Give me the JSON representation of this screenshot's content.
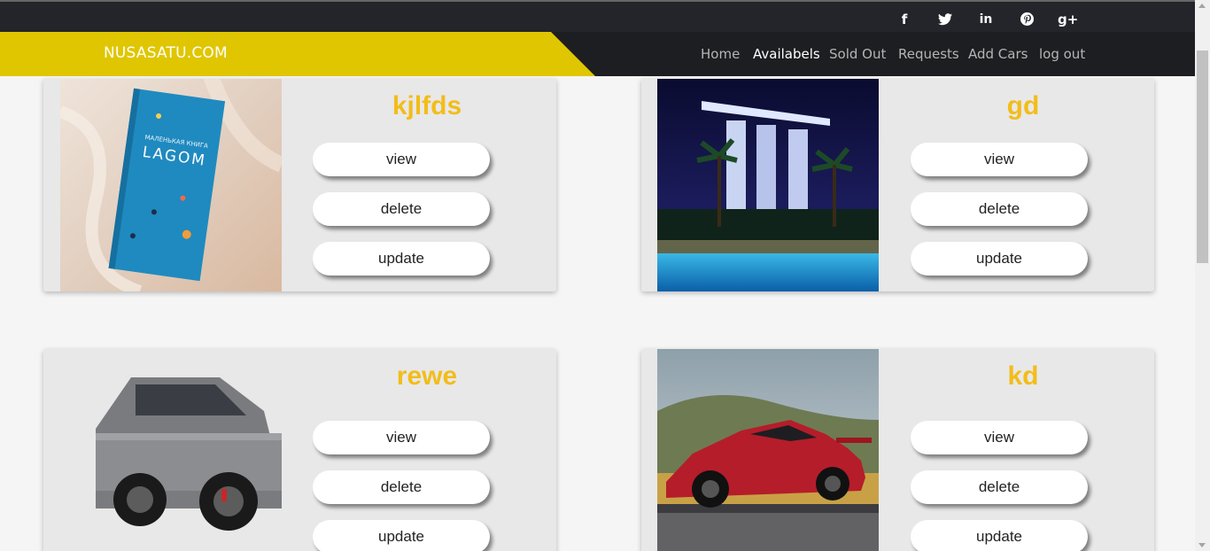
{
  "brand": "NUSASATU.COM",
  "social": [
    {
      "icon": "facebook-icon",
      "glyph": "f"
    },
    {
      "icon": "twitter-icon",
      "glyph": "t"
    },
    {
      "icon": "linkedin-icon",
      "glyph": "in"
    },
    {
      "icon": "pinterest-icon",
      "glyph": "p"
    },
    {
      "icon": "google-plus-icon",
      "glyph": "g+"
    }
  ],
  "nav": [
    "Home",
    "Availabels",
    "Sold Out",
    "Requests",
    "Add Cars",
    "log out"
  ],
  "nav_active": "Availabels",
  "cars": [
    {
      "name": "kjlfds",
      "image": "book-photo"
    },
    {
      "name": "gd",
      "image": "hotel-night-photo"
    },
    {
      "name": "rewe",
      "image": "suv-photo"
    },
    {
      "name": "kd",
      "image": "red-sports-car-photo"
    }
  ],
  "buttons": {
    "view": "view",
    "delete": "delete",
    "update": "update"
  },
  "colors": {
    "accent": "#e0c600",
    "title": "#f2bd1a",
    "navbar": "#1d1e21"
  }
}
